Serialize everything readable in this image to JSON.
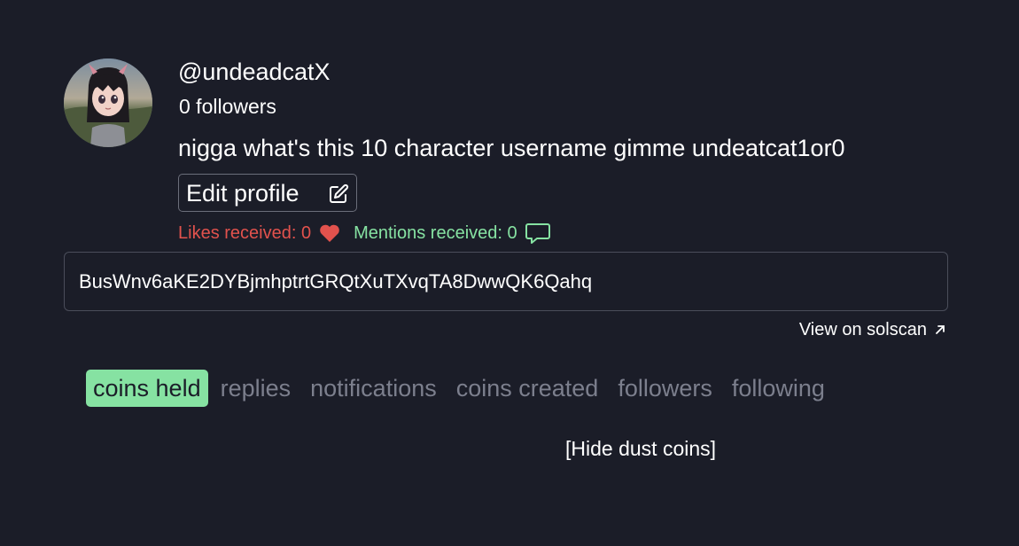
{
  "profile": {
    "username": "@undeadcatX",
    "followers": "0 followers",
    "bio": "nigga what's this 10 character username gimme undeatcat1or0",
    "edit_label": "Edit profile"
  },
  "stats": {
    "likes": "Likes received: 0",
    "mentions": "Mentions received: 0",
    "likes_color": "#e2524d",
    "mentions_color": "#86e2a2"
  },
  "wallet": {
    "address": "BusWnv6aKE2DYBjmhptrtGRQtXuTXvqTA8DwwQK6Qahq",
    "view_link": "View on solscan"
  },
  "tabs": [
    {
      "label": "coins held",
      "active": true
    },
    {
      "label": "replies",
      "active": false
    },
    {
      "label": "notifications",
      "active": false
    },
    {
      "label": "coins created",
      "active": false
    },
    {
      "label": "followers",
      "active": false
    },
    {
      "label": "following",
      "active": false
    }
  ],
  "hide_dust": "[Hide dust coins]",
  "icons": {
    "edit": "edit-square-icon",
    "likes": "heart-icon",
    "mentions": "chat-bubble-icon",
    "external": "arrow-up-right-icon"
  },
  "colors": {
    "background": "#1b1d28",
    "accent": "#86e2a2",
    "inactive_tab": "#7c7f8d"
  }
}
